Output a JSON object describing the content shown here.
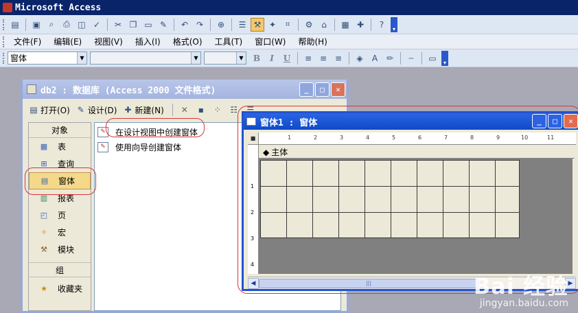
{
  "app": {
    "title": "Microsoft Access"
  },
  "menu": [
    "文件(F)",
    "编辑(E)",
    "视图(V)",
    "插入(I)",
    "格式(O)",
    "工具(T)",
    "窗口(W)",
    "帮助(H)"
  ],
  "format_toolbar": {
    "object_combo": "窗体",
    "bold": "B",
    "italic": "I",
    "underline": "U"
  },
  "db_window": {
    "title": "db2 : 数据库 (Access 2000 文件格式)",
    "toolbar": {
      "open": "打开(O)",
      "design": "设计(D)",
      "new": "新建(N)"
    },
    "objects_header": "对象",
    "objects": [
      "表",
      "查询",
      "窗体",
      "报表",
      "页",
      "宏",
      "模块"
    ],
    "selected_object": "窗体",
    "groups_header": "组",
    "groups": [
      "收藏夹"
    ],
    "list_items": [
      "在设计视图中创建窗体",
      "使用向导创建窗体"
    ]
  },
  "form_window": {
    "title": "窗体1 : 窗体",
    "section_label": "主体",
    "ruler_numbers": [
      "1",
      "2",
      "3",
      "4",
      "5",
      "6",
      "7",
      "8",
      "9",
      "10",
      "11"
    ],
    "left_ruler_numbers": [
      "1",
      "2",
      "3",
      "4"
    ]
  },
  "watermark": {
    "logo": "Bai 经验",
    "url": "jingyan.baidu.com"
  }
}
